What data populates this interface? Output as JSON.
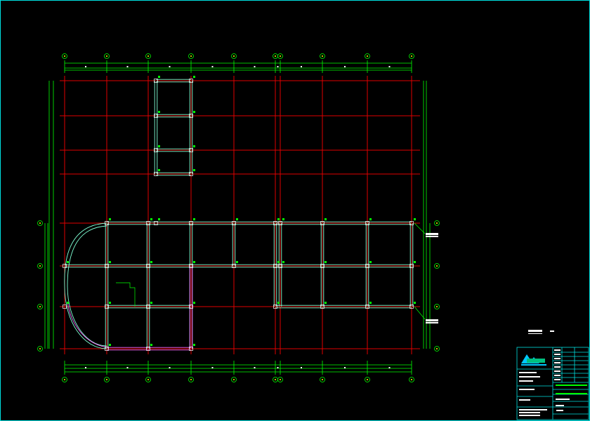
{
  "drawing": {
    "frame_color": "#00e0e0",
    "grid_color": "#e00000",
    "dimension_color": "#00ff00",
    "beam_color": "#7fffd4",
    "highlight_beam_color": "#ff66ff",
    "column_marker_color": "#00ff00",
    "axis_bubble_label_color": "#ffff00"
  },
  "title_block": {
    "logo": "company-logo"
  }
}
